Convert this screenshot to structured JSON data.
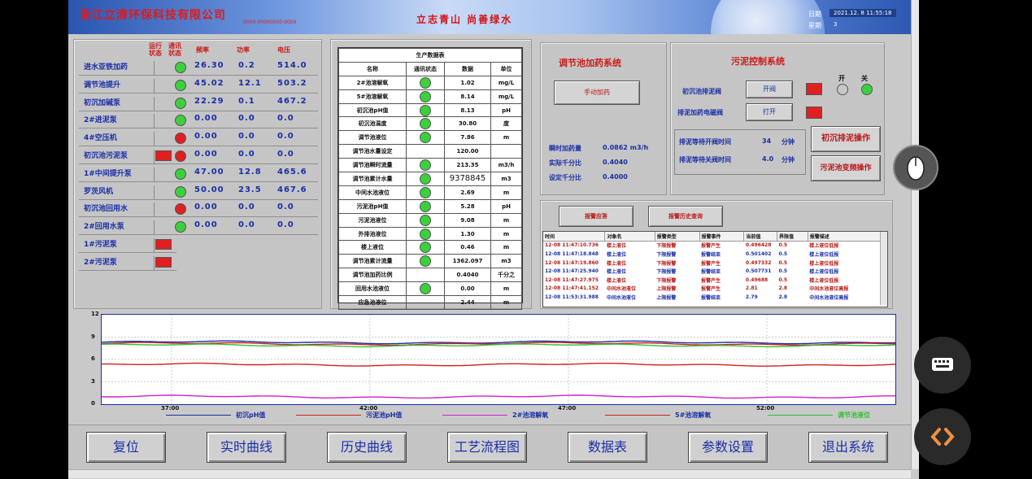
{
  "header": {
    "company": "浙江立清环保科技有限公司",
    "company_sub": "0000-00000000-0000",
    "slogan": "立志青山  尚善绿水",
    "date_label": "日期",
    "date_value": "2021.12. 8  11:55:18",
    "weekday_label": "星期",
    "weekday_value": "3"
  },
  "equipment": {
    "headers": {
      "run_status": "运行\n状态",
      "comm_status": "通讯\n状态",
      "freq": "频率",
      "power": "功率",
      "voltage": "电压"
    },
    "rows": [
      {
        "name": "进水亚铁加药",
        "status": "green",
        "freq": "26.30",
        "power": "0.2",
        "voltage": "514.0"
      },
      {
        "name": "调节池提升",
        "status": "green",
        "freq": "45.02",
        "power": "12.1",
        "voltage": "503.2"
      },
      {
        "name": "初沉加碱泵",
        "status": "green",
        "freq": "22.29",
        "power": "0.1",
        "voltage": "467.2"
      },
      {
        "name": "2#进泥泵",
        "status": "green",
        "freq": "0.00",
        "power": "0.0",
        "voltage": "0.0"
      },
      {
        "name": "4#空压机",
        "status": "red",
        "freq": "0.00",
        "power": "0.0",
        "voltage": "0.0"
      },
      {
        "name": "初沉池污泥泵",
        "status": "red",
        "run_box": true,
        "freq": "0.00",
        "power": "0.0",
        "voltage": "0.0"
      },
      {
        "name": "1#中间提升泵",
        "status": "green",
        "freq": "47.00",
        "power": "12.8",
        "voltage": "465.6"
      },
      {
        "name": "罗茨风机",
        "status": "green",
        "freq": "50.00",
        "power": "23.5",
        "voltage": "467.6"
      },
      {
        "name": "初沉池回用水",
        "status": "red",
        "freq": "0.00",
        "power": "0.0",
        "voltage": "0.0"
      },
      {
        "name": "2#回用水泵",
        "status": "green",
        "freq": "0.00",
        "power": "0.0",
        "voltage": "0.0"
      },
      {
        "name": "1#污泥泵",
        "status": "box"
      },
      {
        "name": "2#污泥泵",
        "status": "box"
      }
    ]
  },
  "production": {
    "title": "生产数据表",
    "headers": [
      "名称",
      "通讯状态",
      "数据",
      "单位"
    ],
    "rows": [
      {
        "name": "2#池溶解氧",
        "dot": true,
        "value": "1.02",
        "unit": "mg/L"
      },
      {
        "name": "5#池溶解氧",
        "dot": true,
        "value": "8.14",
        "unit": "mg/L"
      },
      {
        "name": "初沉池pH值",
        "dot": true,
        "value": "8.13",
        "unit": "pH"
      },
      {
        "name": "初沉池温度",
        "dot": true,
        "value": "30.80",
        "unit": "度"
      },
      {
        "name": "调节池液位",
        "dot": true,
        "value": "7.86",
        "unit": "m"
      },
      {
        "name": "调节池水量设定",
        "dot": false,
        "value": "120.00",
        "unit": ""
      },
      {
        "name": "调节池瞬时流量",
        "dot": true,
        "value": "213.35",
        "unit": "m3/h"
      },
      {
        "name": "调节池累计水量",
        "dot": true,
        "value": "9378845",
        "unit": "m3"
      },
      {
        "name": "中间水池液位",
        "dot": true,
        "value": "2.69",
        "unit": "m"
      },
      {
        "name": "污泥池pH值",
        "dot": true,
        "value": "5.28",
        "unit": "pH"
      },
      {
        "name": "污泥池液位",
        "dot": true,
        "value": "9.08",
        "unit": "m"
      },
      {
        "name": "外排池液位",
        "dot": true,
        "value": "1.30",
        "unit": "m"
      },
      {
        "name": "楼上液位",
        "dot": true,
        "value": "0.46",
        "unit": "m"
      },
      {
        "name": "调节池累计流量",
        "dot": true,
        "value": "1362.097",
        "unit": "m3"
      },
      {
        "name": "调节池加药比例",
        "dot": false,
        "value": "0.4040",
        "unit": "千分之"
      },
      {
        "name": "回用水池液位",
        "dot": true,
        "value": "0.00",
        "unit": "m"
      },
      {
        "name": "应急池液位",
        "dot": false,
        "value": "2.44",
        "unit": "m"
      }
    ]
  },
  "dosing": {
    "title": "调节池加药系统",
    "manual_button": "手动加药",
    "instant_label": "瞬时加药量",
    "instant_value": "0.0862 m3/h",
    "actual_label": "实际千分比",
    "actual_value": "0.4040",
    "set_label": "设定千分比",
    "set_value": "0.4000"
  },
  "sludge": {
    "title": "污泥控制系统",
    "open_label": "开",
    "close_label": "关",
    "valve1_label": "初沉池排泥阀",
    "valve1_button": "开阀",
    "valve2_label": "排泥加药电磁阀",
    "valve2_button": "打开",
    "wait_open_label": "排泥等待开阀时间",
    "wait_open_value": "34",
    "wait_open_unit": "分钟",
    "wait_close_label": "排泥等待关阀时间",
    "wait_close_value": "4.0",
    "wait_close_unit": "分钟",
    "op1_button": "初沉排泥操作",
    "op2_button": "污泥池变频操作"
  },
  "alarm": {
    "ack_button": "报警应答",
    "history_button": "报警历史查询",
    "headers": [
      "时间",
      "对象名",
      "报警类型",
      "报警事件",
      "当前值",
      "界限值",
      "报警描述"
    ],
    "rows": [
      {
        "time": "12-08 11:47:10.736",
        "obj": "楼上液位",
        "type": "下限报警",
        "event": "报警产生",
        "cur": "0.496428",
        "limit": "0.5",
        "desc": "楼上液位低报",
        "color": "#b81818"
      },
      {
        "time": "12-08 11:47:18.848",
        "obj": "楼上液位",
        "type": "下限报警",
        "event": "报警结束",
        "cur": "0.501402",
        "limit": "0.5",
        "desc": "楼上液位低报",
        "color": "#1a2ea8"
      },
      {
        "time": "12-08 11:47:19.860",
        "obj": "楼上液位",
        "type": "下限报警",
        "event": "报警产生",
        "cur": "0.497332",
        "limit": "0.5",
        "desc": "楼上液位低报",
        "color": "#b81818"
      },
      {
        "time": "12-08 11:47:25.940",
        "obj": "楼上液位",
        "type": "下限报警",
        "event": "报警结束",
        "cur": "0.507731",
        "limit": "0.5",
        "desc": "楼上液位低报",
        "color": "#1a2ea8"
      },
      {
        "time": "12-08 11:47:27.975",
        "obj": "楼上液位",
        "type": "下限报警",
        "event": "报警产生",
        "cur": "0.49688",
        "limit": "0.5",
        "desc": "楼上液位低报",
        "color": "#b81818"
      },
      {
        "time": "12-08 11:47:41.152",
        "obj": "中间水池液位",
        "type": "上限报警",
        "event": "报警产生",
        "cur": "2.81",
        "limit": "2.8",
        "desc": "中间水池液位高报",
        "color": "#b81818"
      },
      {
        "time": "12-08 11:53:31.988",
        "obj": "中间水池液位",
        "type": "上限报警",
        "event": "报警结束",
        "cur": "2.79",
        "limit": "2.8",
        "desc": "中间水池液位高报",
        "color": "#1a2ea8"
      }
    ]
  },
  "trend": {
    "y_ticks": [
      "12",
      "9",
      "6",
      "3",
      "0"
    ],
    "x_ticks": [
      "37:00",
      "42:00",
      "47:00",
      "52:00"
    ],
    "y_range": [
      0,
      12
    ],
    "series": [
      {
        "name": "初沉pH值",
        "color": "#1a2ea8",
        "level": 8.3
      },
      {
        "name": "污泥池pH值",
        "color": "#d02020",
        "level": 5.3
      },
      {
        "name": "2#池溶解氧",
        "color": "#d020d0",
        "level": 1.0
      },
      {
        "name": "5#池溶解氧",
        "color": "#d02020",
        "level": 8.1
      },
      {
        "name": "调节池液位",
        "color": "#30c030",
        "level": 7.9
      }
    ]
  },
  "nav": [
    "复位",
    "实时曲线",
    "历史曲线",
    "工艺流程图",
    "数据表",
    "参数设置",
    "退出系统"
  ]
}
